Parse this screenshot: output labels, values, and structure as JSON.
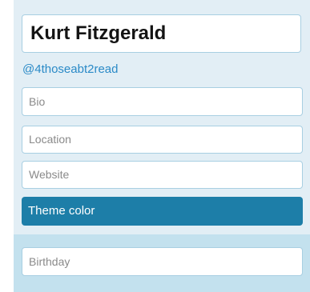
{
  "profile": {
    "name": "Kurt Fitzgerald",
    "handle": "@4thoseabt2read"
  },
  "fields": {
    "bio_placeholder": "Bio",
    "location_placeholder": "Location",
    "website_placeholder": "Website",
    "birthday_placeholder": "Birthday"
  },
  "theme": {
    "label": "Theme color",
    "color": "#1d7ea8"
  },
  "colors": {
    "panel_background": "#e2eef5",
    "lower_panel_background": "#c3e1ee",
    "handle_link": "#2a8ac7"
  }
}
